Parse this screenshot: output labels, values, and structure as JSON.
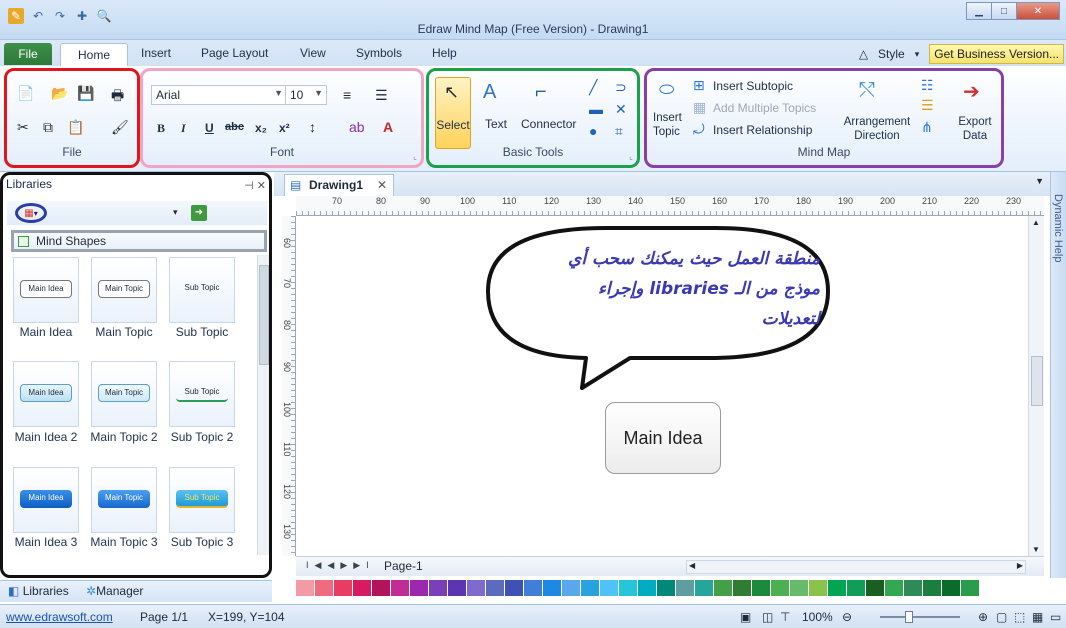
{
  "window": {
    "title": "Edraw Mind Map (Free Version) - Drawing1"
  },
  "menu": {
    "tabs": [
      "File",
      "Home",
      "Insert",
      "Page Layout",
      "View",
      "Symbols",
      "Help"
    ],
    "style_label": "Style",
    "business_button": "Get Business Version..."
  },
  "ribbon": {
    "file_group": {
      "label": "File"
    },
    "font_group": {
      "label": "Font",
      "font_name": "Arial",
      "font_size": "10",
      "format_buttons": [
        "B",
        "I",
        "U",
        "abc",
        "x₂",
        "x²"
      ]
    },
    "basic_tools": {
      "label": "Basic Tools",
      "select": "Select",
      "text": "Text",
      "connector": "Connector"
    },
    "mind_map": {
      "label": "Mind Map",
      "insert_topic": "Insert Topic",
      "insert_subtopic": "Insert Subtopic",
      "add_multiple_topics": "Add Multiple Topics",
      "insert_relationship": "Insert Relationship",
      "arrangement_direction": "Arrangement Direction",
      "export_data": "Export Data"
    }
  },
  "libraries": {
    "title": "Libraries",
    "category": "Mind Shapes",
    "shapes": [
      {
        "thumb": "Main Idea",
        "label": "Main Idea"
      },
      {
        "thumb": "Main Topic",
        "label": "Main Topic"
      },
      {
        "thumb": "Sub Topic",
        "label": "Sub Topic"
      },
      {
        "thumb": "Main Idea",
        "label": "Main Idea 2"
      },
      {
        "thumb": "Main Topic",
        "label": "Main Topic 2"
      },
      {
        "thumb": "Sub Topic",
        "label": "Sub Topic 2"
      },
      {
        "thumb": "Main Idea",
        "label": "Main Idea 3"
      },
      {
        "thumb": "Main Topic",
        "label": "Main Topic 3"
      },
      {
        "thumb": "Sub Topic",
        "label": "Sub Topic 3"
      }
    ],
    "bottom_tabs": [
      "Libraries",
      "Manager"
    ]
  },
  "document": {
    "tab": "Drawing1",
    "ruler_h": [
      "70",
      "80",
      "90",
      "100",
      "110",
      "120",
      "130",
      "140",
      "150",
      "160",
      "170",
      "180",
      "190",
      "200",
      "210",
      "220",
      "230"
    ],
    "ruler_v": [
      "60",
      "70",
      "80",
      "90",
      "100",
      "110",
      "120",
      "130"
    ],
    "annotation_lines": [
      "منطقة العمل حيث يمكنك سحب أي",
      "موذج من الـ libraries وإجراء",
      "لتعديلات"
    ],
    "canvas_shape": "Main Idea",
    "page_tab": "Page-1"
  },
  "side_panel": {
    "label": "Dynamic Help"
  },
  "palette": [
    "#f29aa6",
    "#f06b80",
    "#ea3b62",
    "#d81b60",
    "#b0155a",
    "#c02d94",
    "#9c27b0",
    "#7b3fb8",
    "#5e35b1",
    "#7e6bd0",
    "#5c6bc0",
    "#3f51b5",
    "#3f7fd8",
    "#1e88e5",
    "#5aa7ee",
    "#29a3e0",
    "#4fc3f7",
    "#26c6da",
    "#00acc1",
    "#00897b",
    "#5f9ea0",
    "#26a69a",
    "#43a047",
    "#2e7d32",
    "#1b8a3a",
    "#4caf50",
    "#66bb6a",
    "#8bc34a",
    "#00a651",
    "#0f9d58",
    "#1b5e20",
    "#33a852",
    "#2e8b57",
    "#1a7f3c",
    "#0b6b2a",
    "#2a9d4a"
  ],
  "status": {
    "link": "www.edrawsoft.com",
    "page": "Page 1/1",
    "coords": "X=199, Y=104",
    "zoom": "100%"
  }
}
